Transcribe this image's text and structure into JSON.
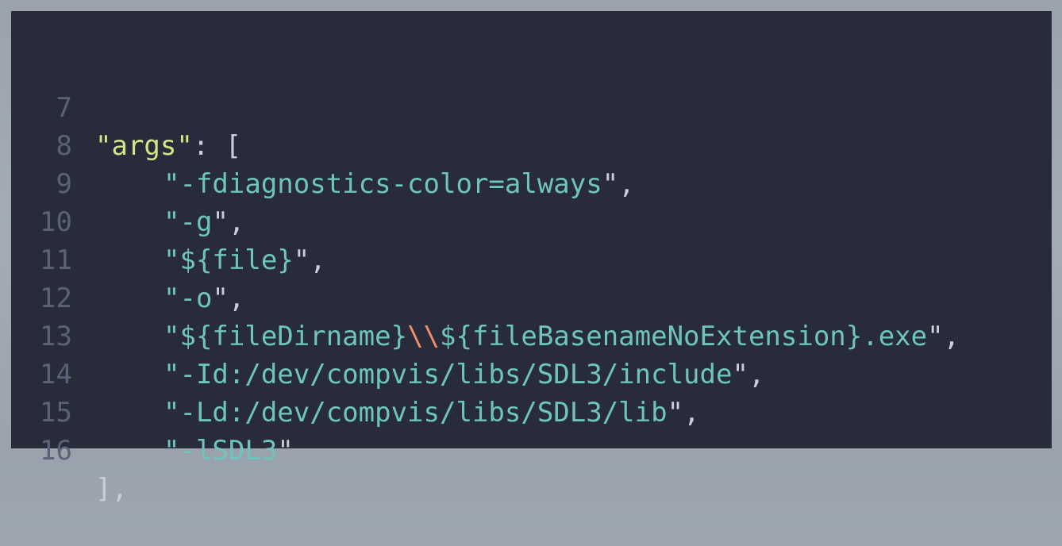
{
  "editor": {
    "lines": [
      {
        "number": "7",
        "key": "args",
        "tail": ": ["
      },
      {
        "number": "8",
        "value": "-fdiagnostics-color=always",
        "suffix": ","
      },
      {
        "number": "9",
        "value": "-g",
        "suffix": ","
      },
      {
        "number": "10",
        "value": "${file}",
        "suffix": ","
      },
      {
        "number": "11",
        "value": "-o",
        "suffix": ","
      },
      {
        "number": "12",
        "value_before": "${fileDirname}",
        "escape": "\\\\",
        "value_after": "${fileBasenameNoExtension}.exe",
        "suffix": ","
      },
      {
        "number": "13",
        "value": "-Id:/dev/compvis/libs/SDL3/include",
        "suffix": ","
      },
      {
        "number": "14",
        "value": "-Ld:/dev/compvis/libs/SDL3/lib",
        "suffix": ","
      },
      {
        "number": "15",
        "value": "-lSDL3",
        "suffix": ""
      },
      {
        "number": "16",
        "text": "],"
      }
    ]
  },
  "colors": {
    "panel_background": "#282c3a",
    "line_number": "#5a6278",
    "json_key": "#d1e68a",
    "string": "#6fc4bb",
    "escape_sequence": "#f08d6a",
    "punctuation": "#c9ced8"
  }
}
